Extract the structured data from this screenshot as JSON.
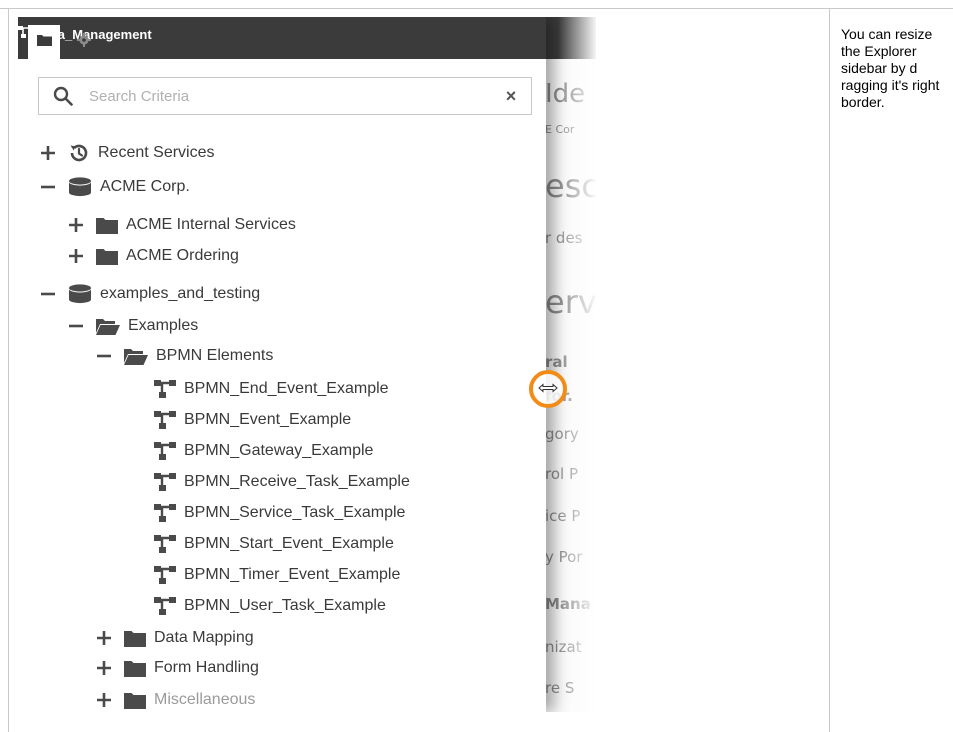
{
  "explorer": {
    "tabs": [
      {
        "name": "folder-tab-icon"
      },
      {
        "name": "settings-tab-icon"
      }
    ],
    "title": "Idea_Management",
    "search": {
      "placeholder": "Search Criteria",
      "value": "",
      "clear_label": "×"
    },
    "tree": [
      {
        "label": "Recent Services",
        "toggle": "expand",
        "icon": "history-icon"
      },
      {
        "label": "ACME Corp.",
        "toggle": "collapse",
        "icon": "database-icon"
      },
      {
        "label": "ACME Internal Services",
        "toggle": "expand",
        "icon": "folder-icon"
      },
      {
        "label": "ACME Ordering",
        "toggle": "expand",
        "icon": "folder-icon"
      },
      {
        "label": "examples_and_testing",
        "toggle": "collapse",
        "icon": "database-icon"
      },
      {
        "label": "Examples",
        "toggle": "collapse",
        "icon": "folder-open-icon"
      },
      {
        "label": "BPMN Elements",
        "toggle": "collapse",
        "icon": "folder-open-icon"
      },
      {
        "label": "BPMN_End_Event_Example",
        "toggle": "none",
        "icon": "service-icon"
      },
      {
        "label": "BPMN_Event_Example",
        "toggle": "none",
        "icon": "service-icon"
      },
      {
        "label": "BPMN_Gateway_Example",
        "toggle": "none",
        "icon": "service-icon"
      },
      {
        "label": "BPMN_Receive_Task_Example",
        "toggle": "none",
        "icon": "service-icon"
      },
      {
        "label": "BPMN_Service_Task_Example",
        "toggle": "none",
        "icon": "service-icon"
      },
      {
        "label": "BPMN_Start_Event_Example",
        "toggle": "none",
        "icon": "service-icon"
      },
      {
        "label": "BPMN_Timer_Event_Example",
        "toggle": "none",
        "icon": "service-icon"
      },
      {
        "label": "BPMN_User_Task_Example",
        "toggle": "none",
        "icon": "service-icon"
      },
      {
        "label": "Data Mapping",
        "toggle": "expand",
        "icon": "folder-icon"
      },
      {
        "label": "Form Handling",
        "toggle": "expand",
        "icon": "folder-icon"
      },
      {
        "label": "Miscellaneous",
        "toggle": "expand",
        "icon": "folder-icon"
      }
    ]
  },
  "background": {
    "fragments": [
      "Ide",
      "E Cor",
      "esc",
      "r des",
      "erv",
      "ral",
      "for.",
      "gory",
      "rol P",
      "ice P",
      "y Por",
      "Mana",
      "nizat",
      "re S"
    ]
  },
  "note": {
    "text": "You can resize the Explorer sidebar by d ragging it's right border."
  },
  "colors": {
    "topbar": "#3b3b3b",
    "accent": "#f28c17",
    "icon": "#4a4a4a"
  }
}
